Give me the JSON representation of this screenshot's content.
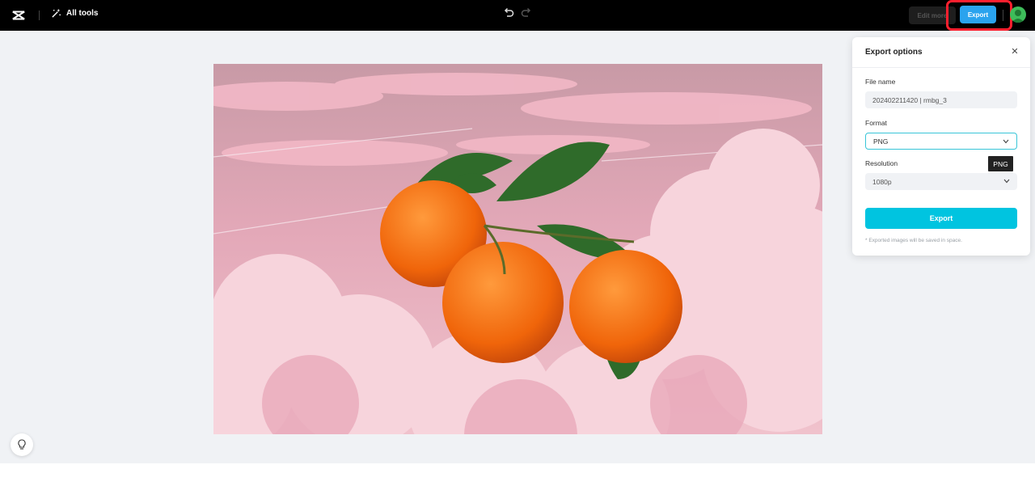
{
  "topbar": {
    "all_tools_label": "All tools",
    "edit_more_label": "Edit more",
    "export_label": "Export"
  },
  "panel": {
    "title": "Export options",
    "close_glyph": "✕",
    "file_name_label": "File name",
    "file_name_value": "202402211420 | rmbg_3",
    "format_label": "Format",
    "format_value": "PNG",
    "resolution_label": "Resolution",
    "resolution_value": "1080p",
    "tooltip": "PNG",
    "export_button": "Export",
    "note": "* Exported images will be saved in space."
  },
  "colors": {
    "accent": "#00c4e0",
    "top_export": "#2aa3ee",
    "highlight": "#ff1f2e"
  },
  "icons": [
    "capcut-logo-icon",
    "magic-wand-icon",
    "undo-icon",
    "redo-icon",
    "avatar-icon",
    "lightbulb-icon",
    "close-icon",
    "chevron-down-icon"
  ]
}
